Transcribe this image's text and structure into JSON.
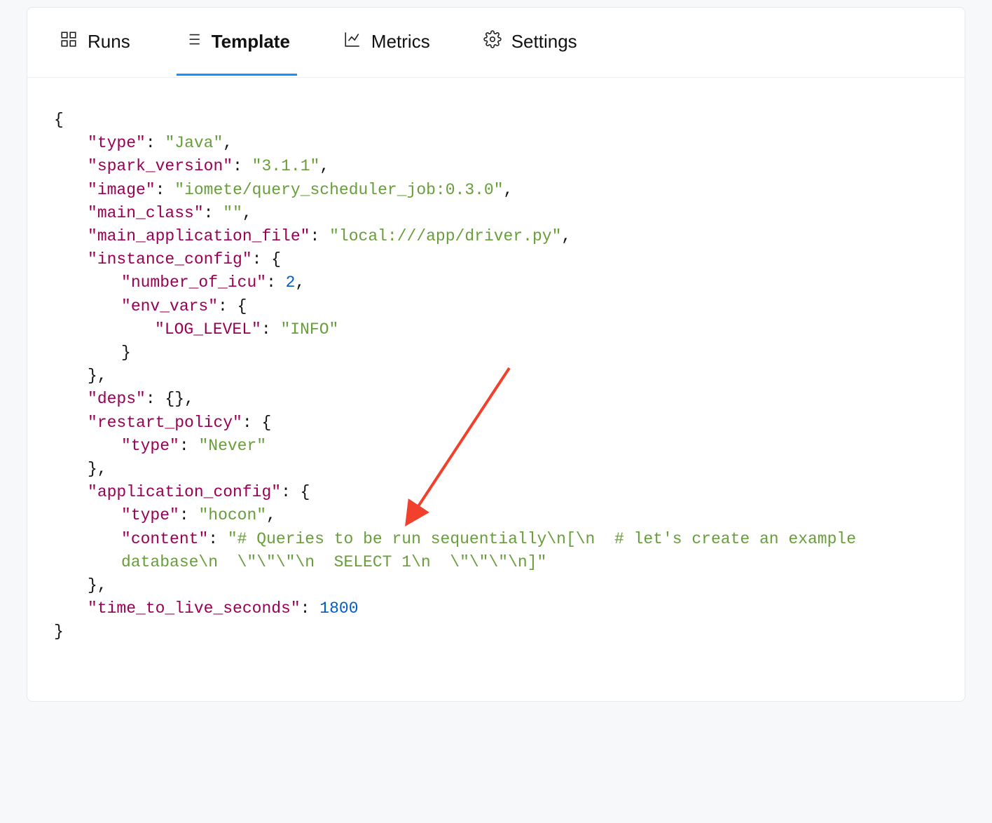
{
  "tabs": {
    "runs": {
      "label": "Runs"
    },
    "template": {
      "label": "Template"
    },
    "metrics": {
      "label": "Metrics"
    },
    "settings": {
      "label": "Settings"
    }
  },
  "active_tab": "template",
  "code": {
    "type": "Java",
    "spark_version": "3.1.1",
    "image": "iomete/query_scheduler_job:0.3.0",
    "main_class": "",
    "main_application_file": "local:///app/driver.py",
    "instance_config": {
      "number_of_icu": 2,
      "env_vars": {
        "LOG_LEVEL": "INFO"
      }
    },
    "deps_display": "{}",
    "restart_policy": {
      "type": "Never"
    },
    "application_config": {
      "type": "hocon",
      "content": "# Queries to be run sequentially\\n[\\n  # let's create an example database\\n  \\\"\\\"\\\"\\n  SELECT 1\\n  \\\"\\\"\\\"\\n]"
    },
    "time_to_live_seconds": 1800
  },
  "keys": {
    "type": "type",
    "spark_version": "spark_version",
    "image": "image",
    "main_class": "main_class",
    "main_application_file": "main_application_file",
    "instance_config": "instance_config",
    "number_of_icu": "number_of_icu",
    "env_vars": "env_vars",
    "log_level": "LOG_LEVEL",
    "deps": "deps",
    "restart_policy": "restart_policy",
    "application_config": "application_config",
    "content": "content",
    "time_to_live_seconds": "time_to_live_seconds"
  }
}
